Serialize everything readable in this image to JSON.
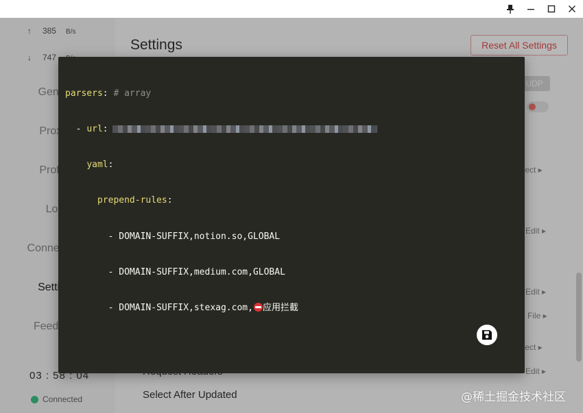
{
  "window": {
    "pin_label": "pin",
    "minimize_label": "minimize",
    "maximize_label": "maximize",
    "close_label": "close"
  },
  "sidebar": {
    "upload": {
      "arrow": "↑",
      "value": "385",
      "unit": "B/s"
    },
    "download": {
      "arrow": "↓",
      "value": "747",
      "unit": "B/s"
    },
    "items": [
      {
        "label": "General"
      },
      {
        "label": "Proxies"
      },
      {
        "label": "Profiles"
      },
      {
        "label": "Logs"
      },
      {
        "label": "Connections"
      },
      {
        "label": "Settings"
      },
      {
        "label": "Feedback"
      }
    ],
    "clock": "03 : 58 : 04",
    "status": "Connected"
  },
  "settings": {
    "title": "Settings",
    "reset_label": "Reset All Settings",
    "pill_label": "UDP",
    "rows": [
      {
        "action": "Select ▸"
      },
      {
        "action": "Edit ▸"
      },
      {
        "action": "Edit ▸"
      },
      {
        "action": "File ▸"
      },
      {
        "action": "Select ▸"
      },
      {
        "label": "Request Headers",
        "action": "Edit ▸"
      },
      {
        "label": "Select After Updated"
      }
    ]
  },
  "editor": {
    "lines": [
      {
        "key": "parsers",
        "punct": ":",
        "comment": " # array"
      },
      {
        "indent": "  ",
        "dash": "- ",
        "key": "url",
        "punct": ":"
      },
      {
        "indent": "    ",
        "key": "yaml",
        "punct": ":"
      },
      {
        "indent": "      ",
        "key": "prepend-rules",
        "punct": ":"
      },
      {
        "indent": "        ",
        "text": "- DOMAIN-SUFFIX,notion.so,GLOBAL"
      },
      {
        "indent": "        ",
        "text": "- DOMAIN-SUFFIX,medium.com,GLOBAL"
      },
      {
        "indent": "        ",
        "text": "- DOMAIN-SUFFIX,stexag.com,",
        "suffix": "应用拦截"
      }
    ],
    "save_label": "save"
  },
  "watermark": "@稀土掘金技术社区",
  "colors": {
    "editor_bg": "#272822",
    "key": "#e6db74",
    "text": "#f8f8f2",
    "comment": "#8f8f8f",
    "danger": "#e05050",
    "connected": "#3cc38a"
  }
}
